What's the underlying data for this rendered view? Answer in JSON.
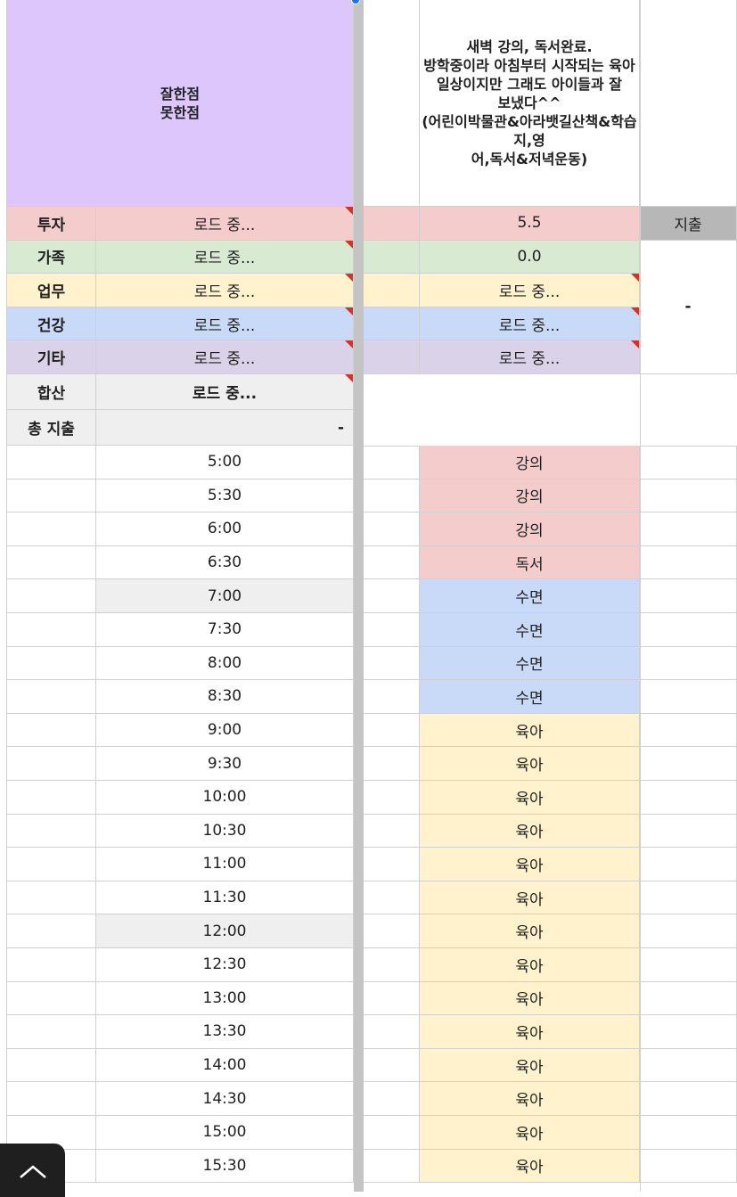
{
  "header": {
    "label_cell": "잘한점\n못한점",
    "diary": "새벽 강의, 독서완료.\n방학중이라 아침부터 시작되는 육아\n일상이지만 그래도 아이들과 잘\n보냈다^^\n(어린이박물관&아라뱃길산책&학습지,영\n어,독서&저녁운동)"
  },
  "summary": {
    "rows": [
      {
        "category": "투자",
        "value": "로드 중...",
        "day": "5.5"
      },
      {
        "category": "가족",
        "value": "로드 중...",
        "day": "0.0"
      },
      {
        "category": "업무",
        "value": "로드 중...",
        "day": "로드 중..."
      },
      {
        "category": "건강",
        "value": "로드 중...",
        "day": "로드 중..."
      },
      {
        "category": "기타",
        "value": "로드 중...",
        "day": "로드 중..."
      }
    ],
    "total_label": "합산",
    "total_value": "로드 중...",
    "expense_label": "총 지출",
    "expense_value": "-",
    "expense_header": "지출",
    "expense_dash": "-"
  },
  "schedule": [
    {
      "time": "5:00",
      "activity": "강의"
    },
    {
      "time": "5:30",
      "activity": "강의"
    },
    {
      "time": "6:00",
      "activity": "강의"
    },
    {
      "time": "6:30",
      "activity": "독서"
    },
    {
      "time": "7:00",
      "activity": "수면"
    },
    {
      "time": "7:30",
      "activity": "수면"
    },
    {
      "time": "8:00",
      "activity": "수면"
    },
    {
      "time": "8:30",
      "activity": "수면"
    },
    {
      "time": "9:00",
      "activity": "육아"
    },
    {
      "time": "9:30",
      "activity": "육아"
    },
    {
      "time": "10:00",
      "activity": "육아"
    },
    {
      "time": "10:30",
      "activity": "육아"
    },
    {
      "time": "11:00",
      "activity": "육아"
    },
    {
      "time": "11:30",
      "activity": "육아"
    },
    {
      "time": "12:00",
      "activity": "육아"
    },
    {
      "time": "12:30",
      "activity": "육아"
    },
    {
      "time": "13:00",
      "activity": "육아"
    },
    {
      "time": "13:30",
      "activity": "육아"
    },
    {
      "time": "14:00",
      "activity": "육아"
    },
    {
      "time": "14:30",
      "activity": "육아"
    },
    {
      "time": "15:00",
      "activity": "육아"
    },
    {
      "time": "15:30",
      "activity": "육아"
    }
  ],
  "colors": {
    "purple": "#dcc6fb",
    "invest": "#f4cccc",
    "family": "#d9ead3",
    "work": "#fff2cc",
    "health": "#c9daf8",
    "etc": "#d9d2e9",
    "gray": "#efefef",
    "expense_header": "#b7b7b7"
  },
  "icons": {
    "fab": "chevron-up-icon"
  }
}
